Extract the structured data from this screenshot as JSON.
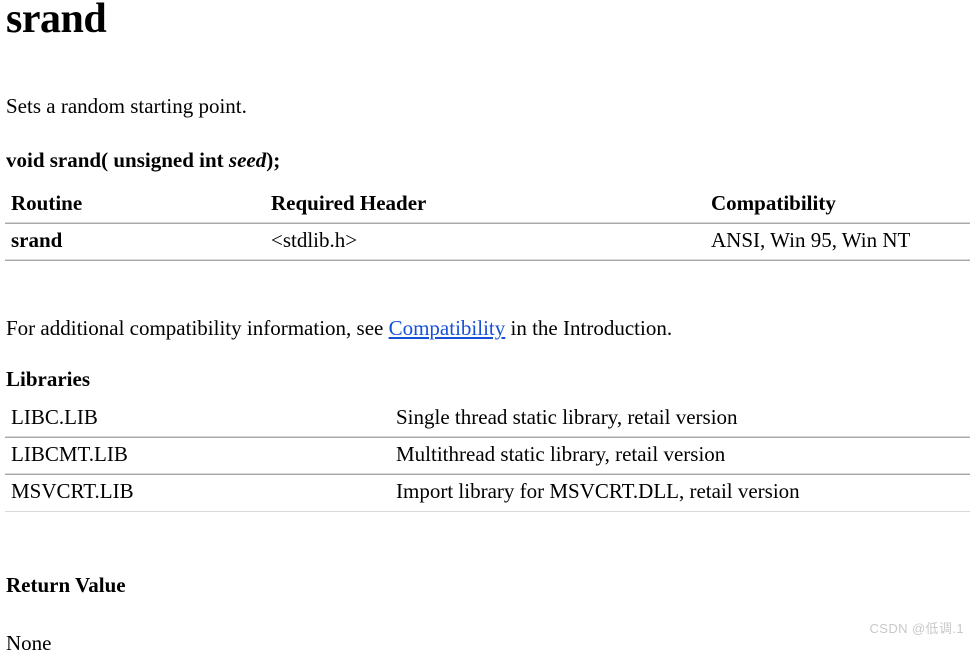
{
  "document": {
    "title": "srand",
    "summary": "Sets a random starting point.",
    "syntax": {
      "prefix": "void srand( unsigned int",
      "param": "seed",
      "suffix": ");"
    },
    "compat_note": {
      "before": "For additional compatibility information, see",
      "link": "Compatibility",
      "after": "in the Introduction."
    }
  },
  "routine_table": {
    "headers": {
      "routine": "Routine",
      "required_header": "Required Header",
      "compatibility": "Compatibility"
    },
    "rows": [
      {
        "routine": "srand",
        "required_header": "<stdlib.h>",
        "compatibility": "ANSI, Win 95, Win NT"
      }
    ]
  },
  "libraries_section": {
    "heading": "Libraries",
    "rows": [
      {
        "library": "LIBC.LIB",
        "description": "Single thread static library, retail version"
      },
      {
        "library": "LIBCMT.LIB",
        "description": "Multithread static library, retail version"
      },
      {
        "library": "MSVCRT.LIB",
        "description": "Import library for MSVCRT.DLL, retail version"
      }
    ]
  },
  "return_value_section": {
    "heading": "Return Value",
    "value": "None"
  },
  "watermark": {
    "text": "CSDN @低调.1"
  },
  "colors": {
    "link": "#1551d6",
    "rule_light": "#d9d9d9",
    "rule_dark": "#a8a8a8",
    "watermark": "#c8c8c8",
    "text": "#000000",
    "background": "#ffffff"
  }
}
